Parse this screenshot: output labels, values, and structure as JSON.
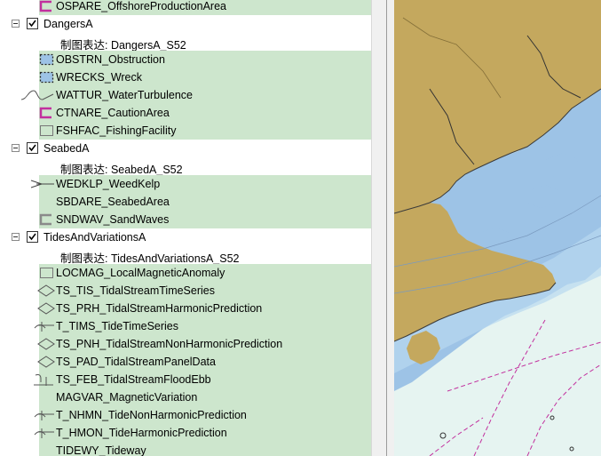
{
  "toc": {
    "rows": [
      {
        "kind": "layer",
        "name": "layer-ospare",
        "label": "OSPARE_OffshoreProductionArea",
        "symbol": "magenta-bracket-icon",
        "highlight": true
      },
      {
        "kind": "group",
        "name": "group-dangersa",
        "label": "DangersA"
      },
      {
        "kind": "rep",
        "name": "rep-dangersa",
        "label": "制图表达: DangersA_S52"
      },
      {
        "kind": "layer",
        "name": "layer-obstrn",
        "label": "OBSTRN_Obstruction",
        "symbol": "dotted-blue-box-icon",
        "highlight": true
      },
      {
        "kind": "layer",
        "name": "layer-wrecks",
        "label": "WRECKS_Wreck",
        "symbol": "dotted-blue-box-icon",
        "highlight": true
      },
      {
        "kind": "layer",
        "name": "layer-wattur",
        "label": "WATTUR_WaterTurbulence",
        "symbol": "wave-line-icon",
        "highlight": true
      },
      {
        "kind": "layer",
        "name": "layer-ctnare",
        "label": "CTNARE_CautionArea",
        "symbol": "magenta-bracket-icon",
        "highlight": true
      },
      {
        "kind": "layer",
        "name": "layer-fshfac",
        "label": "FSHFAC_FishingFacility",
        "symbol": "grey-box-icon",
        "highlight": true
      },
      {
        "kind": "group",
        "name": "group-seabeda",
        "label": "SeabedA"
      },
      {
        "kind": "rep",
        "name": "rep-seabeda",
        "label": "制图表达: SeabedA_S52"
      },
      {
        "kind": "layer",
        "name": "layer-wedklp",
        "label": "WEDKLP_WeedKelp",
        "symbol": "arrow-line-icon",
        "highlight": true
      },
      {
        "kind": "layer",
        "name": "layer-sbdare",
        "label": "SBDARE_SeabedArea",
        "symbol": "",
        "highlight": true
      },
      {
        "kind": "layer",
        "name": "layer-sndwav",
        "label": "SNDWAV_SandWaves",
        "symbol": "grey-bracket-icon",
        "highlight": true
      },
      {
        "kind": "group",
        "name": "group-tidesandvariationsa",
        "label": "TidesAndVariationsA"
      },
      {
        "kind": "rep",
        "name": "rep-tidesandvariationsa",
        "label": "制图表达: TidesAndVariationsA_S52"
      },
      {
        "kind": "layer",
        "name": "layer-locmag",
        "label": "LOCMAG_LocalMagneticAnomaly",
        "symbol": "grey-box-icon",
        "highlight": true
      },
      {
        "kind": "layer",
        "name": "layer-ts-tis",
        "label": "TS_TIS_TidalStreamTimeSeries",
        "symbol": "diamond-icon",
        "highlight": true
      },
      {
        "kind": "layer",
        "name": "layer-ts-prh",
        "label": "TS_PRH_TidalStreamHarmonicPrediction",
        "symbol": "diamond-icon",
        "highlight": true
      },
      {
        "kind": "layer",
        "name": "layer-t-tims",
        "label": "T_TIMS_TideTimeSeries",
        "symbol": "tide-gauge-icon",
        "highlight": true
      },
      {
        "kind": "layer",
        "name": "layer-ts-pnh",
        "label": "TS_PNH_TidalStreamNonHarmonicPrediction",
        "symbol": "diamond-icon",
        "highlight": true
      },
      {
        "kind": "layer",
        "name": "layer-ts-pad",
        "label": "TS_PAD_TidalStreamPanelData",
        "symbol": "diamond-icon",
        "highlight": true
      },
      {
        "kind": "layer",
        "name": "layer-ts-feb",
        "label": "TS_FEB_TidalStreamFloodEbb",
        "symbol": "flood-ebb-icon",
        "highlight": true
      },
      {
        "kind": "layer",
        "name": "layer-magvar",
        "label": "MAGVAR_MagneticVariation",
        "symbol": "",
        "highlight": true
      },
      {
        "kind": "layer",
        "name": "layer-t-nhmn",
        "label": "T_NHMN_TideNonHarmonicPrediction",
        "symbol": "tide-gauge-icon",
        "highlight": true
      },
      {
        "kind": "layer",
        "name": "layer-t-hmon",
        "label": "T_HMON_TideHarmonicPrediction",
        "symbol": "tide-gauge-icon",
        "highlight": true
      },
      {
        "kind": "layer",
        "name": "layer-tidewy",
        "label": "TIDEWY_Tideway",
        "symbol": "",
        "highlight": true
      }
    ]
  },
  "colors": {
    "highlight": "#cde6cd",
    "land": "#c4a85e",
    "shallow": "#9dc3e6",
    "shallow_light": "#b8d8f0",
    "deep": "#e6f4f1",
    "magenta": "#c2309e"
  }
}
